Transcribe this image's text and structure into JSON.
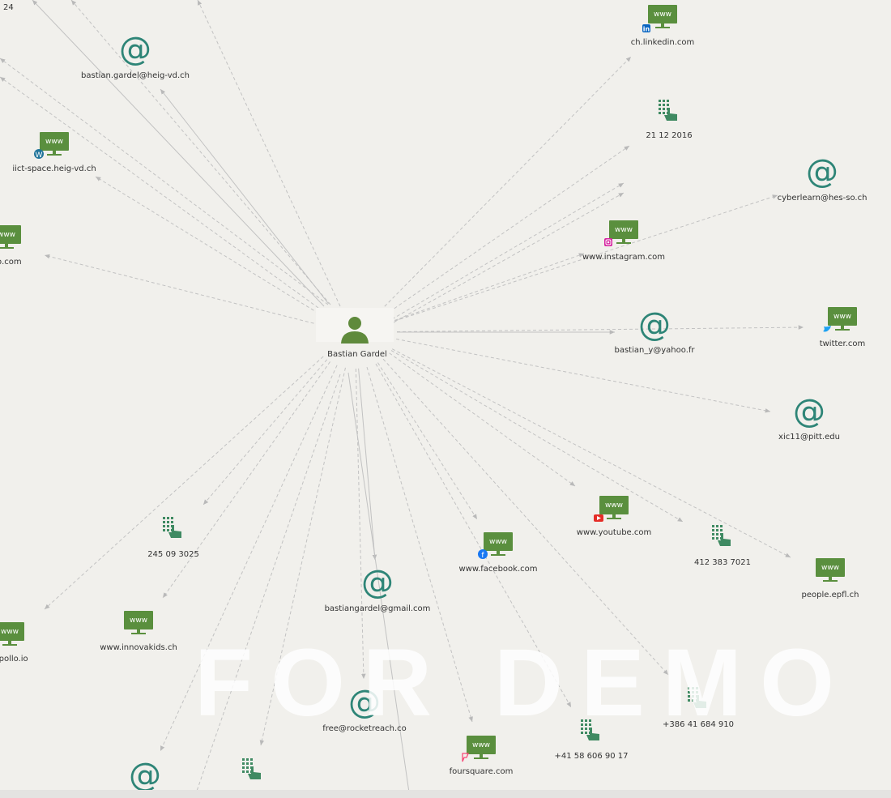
{
  "watermark": "FOR DEMO USE ONLY",
  "colors": {
    "background": "#f1f0ec",
    "edge": "#c2c2c2",
    "person_icon": "#5f8a3c",
    "web_icon": "#5a8f3e",
    "email_icon": "#2e8577",
    "phone_icon": "#3f8a62"
  },
  "center": {
    "label": "Bastian Gardel",
    "icon": "person-icon"
  },
  "nodes": [
    {
      "type": "web",
      "label": "ch.linkedin.com",
      "badge": "linkedin"
    },
    {
      "type": "phone",
      "label": "21 12 2016"
    },
    {
      "type": "email",
      "label": "cyberlearn@hes-so.ch"
    },
    {
      "type": "web",
      "label": "www.instagram.com",
      "badge": "instagram"
    },
    {
      "type": "email",
      "label": "bastian_y@yahoo.fr"
    },
    {
      "type": "web",
      "label": "twitter.com",
      "badge": "twitter"
    },
    {
      "type": "email",
      "label": "xic11@pitt.edu"
    },
    {
      "type": "web",
      "label": "www.youtube.com",
      "badge": "youtube"
    },
    {
      "type": "phone",
      "label": "412 383 7021"
    },
    {
      "type": "web",
      "label": "people.epfl.ch"
    },
    {
      "type": "web",
      "label": "www.facebook.com",
      "badge": "facebook"
    },
    {
      "type": "phone",
      "label": "+386 41 684 910"
    },
    {
      "type": "phone",
      "label": "+41 58 606 90 17"
    },
    {
      "type": "web",
      "label": "foursquare.com",
      "badge": "foursquare"
    },
    {
      "type": "email",
      "label": "bastiangardel@gmail.com"
    },
    {
      "type": "email",
      "label": "free@rocketreach.co"
    },
    {
      "type": "phone",
      "label": "245 09 3025"
    },
    {
      "type": "web",
      "label": "www.innovakids.ch"
    },
    {
      "type": "web",
      "label": ".apollo.io"
    },
    {
      "type": "email",
      "label": ""
    },
    {
      "type": "phone",
      "label": ""
    },
    {
      "type": "email",
      "label": "bastian.gardel@heig-vd.ch"
    },
    {
      "type": "web",
      "label": "iict-space.heig-vd.ch",
      "badge": "wordpress"
    },
    {
      "type": "web",
      "label": "ub.com"
    },
    {
      "type": "text",
      "label": "24"
    }
  ]
}
